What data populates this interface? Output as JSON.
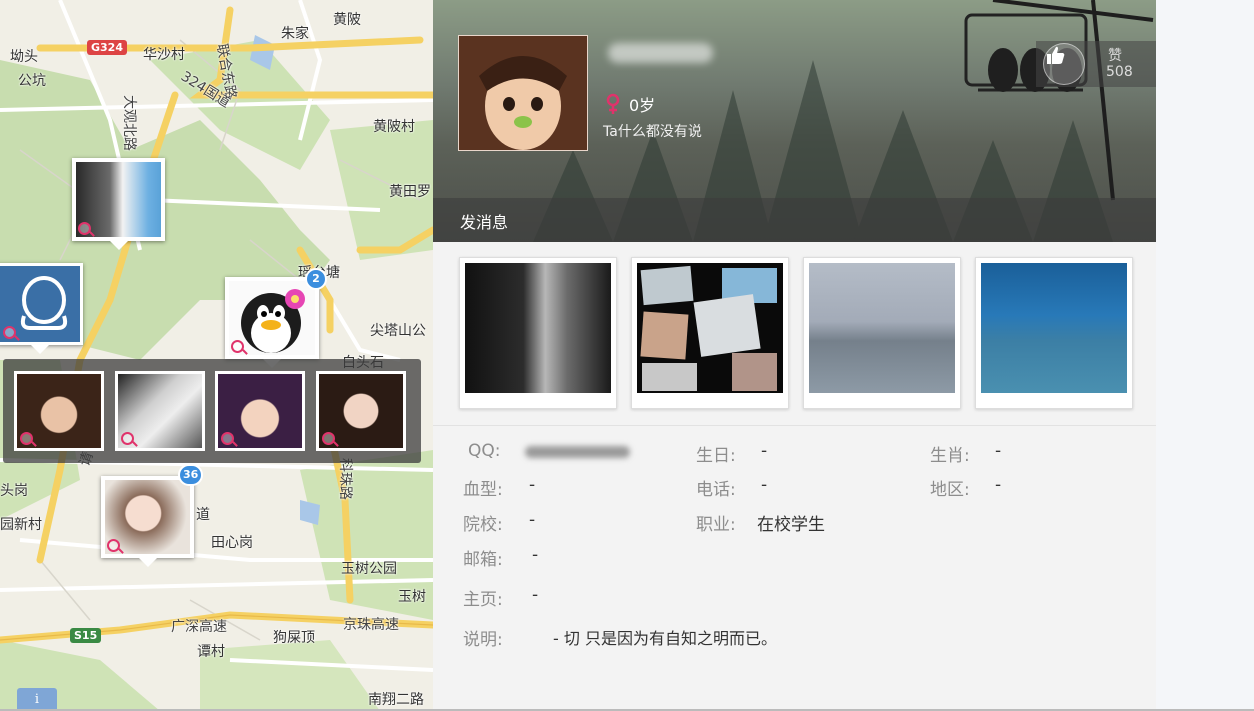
{
  "map": {
    "places": [
      "坳头",
      "公坑",
      "华沙村",
      "朱家",
      "黄陂",
      "联合东路",
      "324国道",
      "大观北路",
      "黄陂村",
      "黄田罗",
      "瑶台塘",
      "尖塔山公",
      "白头石",
      "头岗",
      "园新村",
      "科珠路",
      "道",
      "田心岗",
      "玉树公园",
      "玉树",
      "广深高速",
      "京珠高速",
      "狗屎顶",
      "谭村",
      "南翔二路",
      "请"
    ],
    "shields": [
      "G324",
      "S15"
    ],
    "badges": [
      "2",
      "36"
    ],
    "info_button": "i"
  },
  "profile": {
    "age": "0岁",
    "status": "Ta什么都没有说",
    "like_label": "赞",
    "like_count": "508",
    "send_message": "发消息"
  },
  "fields": [
    {
      "label": "QQ:",
      "value": ""
    },
    {
      "label": "生日:",
      "value": "-"
    },
    {
      "label": "生肖:",
      "value": "-"
    },
    {
      "label": "血型:",
      "value": "-"
    },
    {
      "label": "电话:",
      "value": "-"
    },
    {
      "label": "地区:",
      "value": "-"
    },
    {
      "label": "院校:",
      "value": "-"
    },
    {
      "label": "职业:",
      "value": "在校学生"
    },
    {
      "label": "邮箱:",
      "value": "-"
    },
    {
      "label": "主页:",
      "value": "-"
    },
    {
      "label": "说明:",
      "value": "- 切 只是因为有自知之明而已。"
    }
  ],
  "colors": {
    "gender_female": "#e0336b",
    "badge_blue": "#3b8ede",
    "map_park": "#c9deb0",
    "map_road_yellow": "#f7d564"
  }
}
